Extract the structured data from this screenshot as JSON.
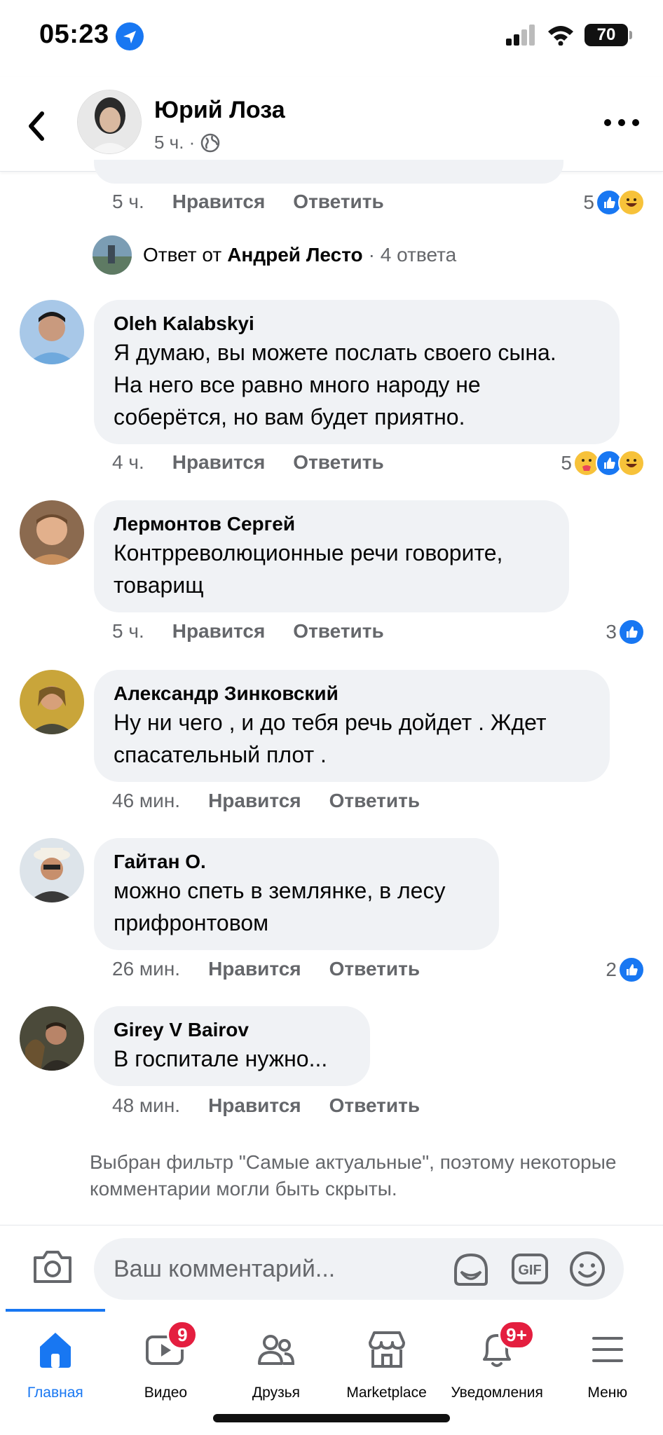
{
  "status_bar": {
    "time": "05:23",
    "battery": "70"
  },
  "header": {
    "name": "Юрий Лоза",
    "meta": "5 ч. ·"
  },
  "top_comment": {
    "time": "5 ч.",
    "like": "Нравится",
    "reply": "Ответить",
    "reaction_count": "5"
  },
  "reply_summary": {
    "prefix": "Ответ от",
    "author": "Андрей Лесто",
    "suffix": "· 4 ответа"
  },
  "comments": [
    {
      "author": "Oleh Kalabskyi",
      "text": "Я думаю, вы можете послать своего сына.\nНа него все равно много народу не\nсоберётся,  но вам будет приятно.",
      "time": "4 ч.",
      "like": "Нравится",
      "reply": "Ответить",
      "reaction_count": "5"
    },
    {
      "author": "Лермонтов Сергей",
      "text": "Контрреволюционные речи говорите,\nтоварищ",
      "time": "5 ч.",
      "like": "Нравится",
      "reply": "Ответить",
      "reaction_count": "3"
    },
    {
      "author": "Александр Зинковский",
      "text": "Ну ни чего , и до тебя речь дойдет . Ждет\nспасательный плот .",
      "time": "46 мин.",
      "like": "Нравится",
      "reply": "Ответить",
      "reaction_count": ""
    },
    {
      "author": "Гайтан О.",
      "text": "можно спеть в землянке, в лесу\nприфронтовом",
      "time": "26 мин.",
      "like": "Нравится",
      "reply": "Ответить",
      "reaction_count": "2"
    },
    {
      "author": "Girey V Bairov",
      "text": "В госпитале нужно...",
      "time": "48 мин.",
      "like": "Нравится",
      "reply": "Ответить",
      "reaction_count": ""
    }
  ],
  "filter_note": "Выбран фильтр \"Самые актуальные\", поэтому некоторые комментарии могли быть скрыты.",
  "composer": {
    "placeholder": "Ваш комментарий..."
  },
  "nav": [
    {
      "label": "Главная",
      "icon": "home-icon",
      "badge": ""
    },
    {
      "label": "Видео",
      "icon": "video-icon",
      "badge": "9"
    },
    {
      "label": "Друзья",
      "icon": "friends-icon",
      "badge": ""
    },
    {
      "label": "Marketplace",
      "icon": "marketplace-icon",
      "badge": ""
    },
    {
      "label": "Уведомления",
      "icon": "bell-icon",
      "badge": "9+"
    },
    {
      "label": "Меню",
      "icon": "menu-icon",
      "badge": ""
    }
  ],
  "colors": {
    "accent": "#1877f2",
    "bubble": "#f0f2f5",
    "muted": "#65676b",
    "badge": "#e41e3f"
  }
}
